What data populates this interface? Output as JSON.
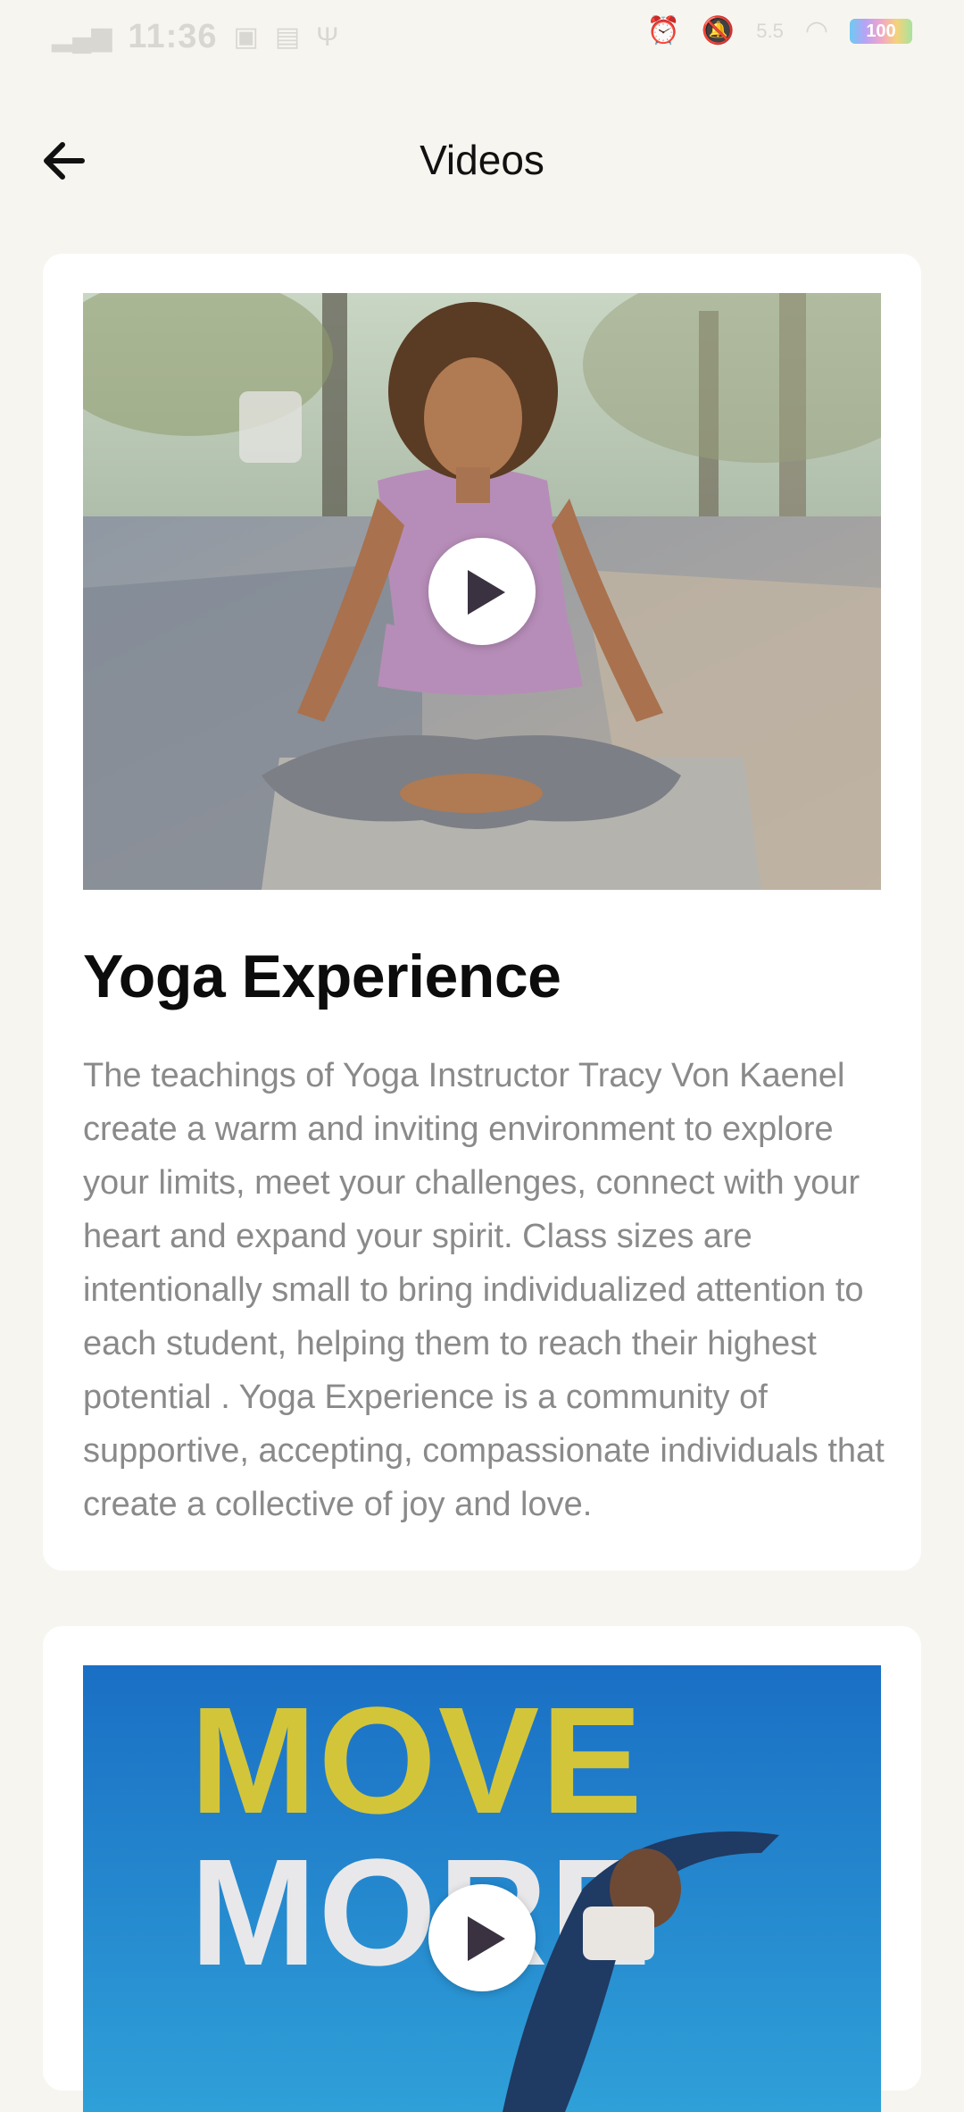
{
  "status_bar": {
    "signal": "4G",
    "time": "11:36",
    "net_speed": "5.5",
    "battery": "100"
  },
  "header": {
    "title": "Videos"
  },
  "videos": [
    {
      "title": "Yoga Experience",
      "description": "The teachings of Yoga Instructor Tracy Von Kaenel create a warm and inviting environment to explore your limits, meet your challenges, connect with your heart and expand your spirit.  Class sizes are intentionally small to bring individualized attention to each student, helping them to reach their highest potential .  Yoga Experience is a community of supportive, accepting, compassionate individuals that create a collective of joy and love."
    },
    {
      "title": "",
      "thumbnail_text": [
        "MOVE",
        "MORE"
      ]
    }
  ],
  "colors": {
    "background": "#f7f5f0",
    "card": "#ffffff",
    "play_icon": "#3a3240",
    "move_yellow": "#d3c53a",
    "move_white": "#e8e8ea",
    "thumb_blue": "#1a6fc4"
  }
}
